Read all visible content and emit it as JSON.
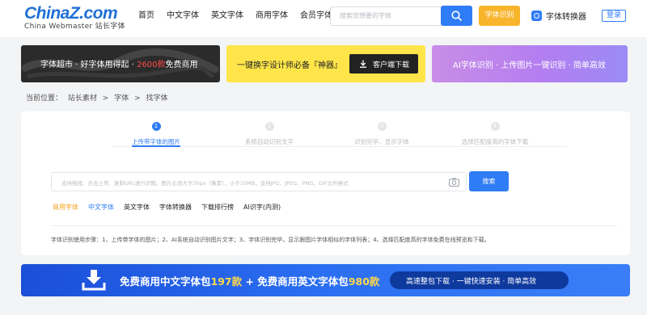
{
  "header": {
    "logo_main": "ChinaZ.com",
    "logo_sub": "China Webmaster 站长字体",
    "nav": [
      "首页",
      "中文字体",
      "英文字体",
      "商用字体",
      "会员字体"
    ],
    "search_placeholder": "搜索您想要的字体",
    "font_id_label": "字体识别",
    "converter_label": "字体转换器",
    "login_label": "登录"
  },
  "banners": {
    "b1_prefix": "字体超市 · 好字体用得起 · ",
    "b1_highlight": "2600款",
    "b1_suffix": "免费商用",
    "b2_text": "一键换字设计师必备『神器』",
    "b2_button": "客户端下载",
    "b3_text": "AI字体识别 · 上传图片一键识别 · 简单高效"
  },
  "breadcrumb": [
    "当前位置：",
    "站长素材",
    ">",
    "字体",
    ">",
    "找字体"
  ],
  "steps": [
    {
      "num": "1",
      "label": "上传带字体的图片"
    },
    {
      "num": "2",
      "label": "系统自动识别文字"
    },
    {
      "num": "3",
      "label": "识别完毕，显示字体"
    },
    {
      "num": "4",
      "label": "选择匹配度高的字体下载"
    }
  ],
  "upload_placeholder": "支持拖拽、点击上传、复制URL进行识图。图片必须大于30px（像素），小于10MB，支持JPG、JPEG、PNG、GIF文件格式",
  "search_button": "搜索",
  "tags": [
    "商用字体",
    "中文字体",
    "英文字体",
    "字体转换器",
    "下载排行榜",
    "AI识字(内测)"
  ],
  "description": "字体识别使用步骤：1、上传带字体的图片；2、AI系统自动识别图片文字；3、字体识别完毕，显示跟图片字体相似的字体列表；4、选择匹配度高的字体免费在线预览和下载。",
  "bottom_banner": {
    "t1": "免费商用中文字体包",
    "n1": "197款",
    "plus": " + ",
    "t2": "免费商用英文字体包",
    "n2": "980款",
    "pill": "高速整包下载 · 一键快速安装 · 简单高效"
  },
  "colors": {
    "accent_blue": "#2f7cf6",
    "orange": "#f8b42b",
    "yellow": "#ffe54a"
  }
}
